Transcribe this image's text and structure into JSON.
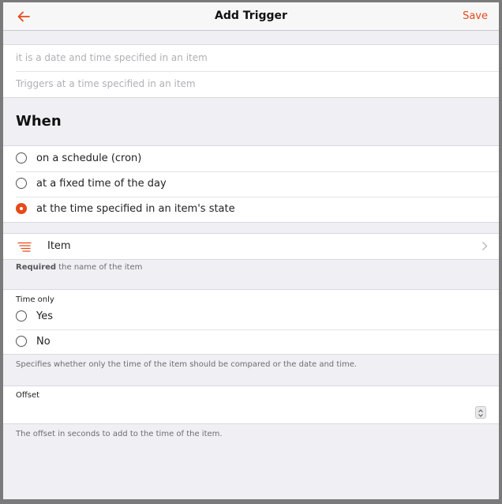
{
  "navbar": {
    "title": "Add Trigger",
    "save_label": "Save",
    "back_icon": "arrow-left-icon"
  },
  "form": {
    "label_placeholder": "it is a date and time specified in an item",
    "description_placeholder": "Triggers at a time specified in an item"
  },
  "when": {
    "title": "When",
    "options": [
      {
        "label": "on a schedule (cron)",
        "checked": false
      },
      {
        "label": "at a fixed time of the day",
        "checked": false
      },
      {
        "label": "at the time specified in an item's state",
        "checked": true
      }
    ]
  },
  "item_field": {
    "label": "Item",
    "icon": "list-icon",
    "required_prefix": "Required",
    "required_text": " the name of the item"
  },
  "time_only": {
    "label": "Time only",
    "options": [
      {
        "label": "Yes",
        "checked": false
      },
      {
        "label": "No",
        "checked": false
      }
    ],
    "description": "Specifies whether only the time of the item should be compared or the date and time."
  },
  "offset": {
    "label": "Offset",
    "value": "",
    "description": "The offset in seconds to add to the time of the item."
  },
  "colors": {
    "accent": "#e64a19",
    "background": "#efeff4"
  }
}
